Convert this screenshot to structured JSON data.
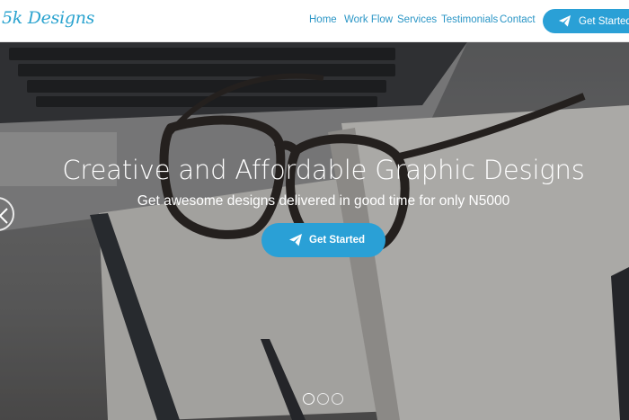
{
  "header": {
    "logo": "5k Designs",
    "nav": [
      "Home",
      "Work Flow",
      "Services",
      "Testimonials",
      "Contact"
    ],
    "cta_label": "Get Started"
  },
  "hero": {
    "title": "Creative and Affordable Graphic Designs",
    "subtitle": "Get awesome designs delivered in good time for only N5000",
    "cta_label": "Get Started",
    "slides": 3,
    "active_slide": 1
  },
  "colors": {
    "accent": "#2aa0d6",
    "nav_text": "#2b96c6"
  },
  "icons": {
    "cta": "paper-plane-icon",
    "prev": "chevron-left-icon"
  }
}
